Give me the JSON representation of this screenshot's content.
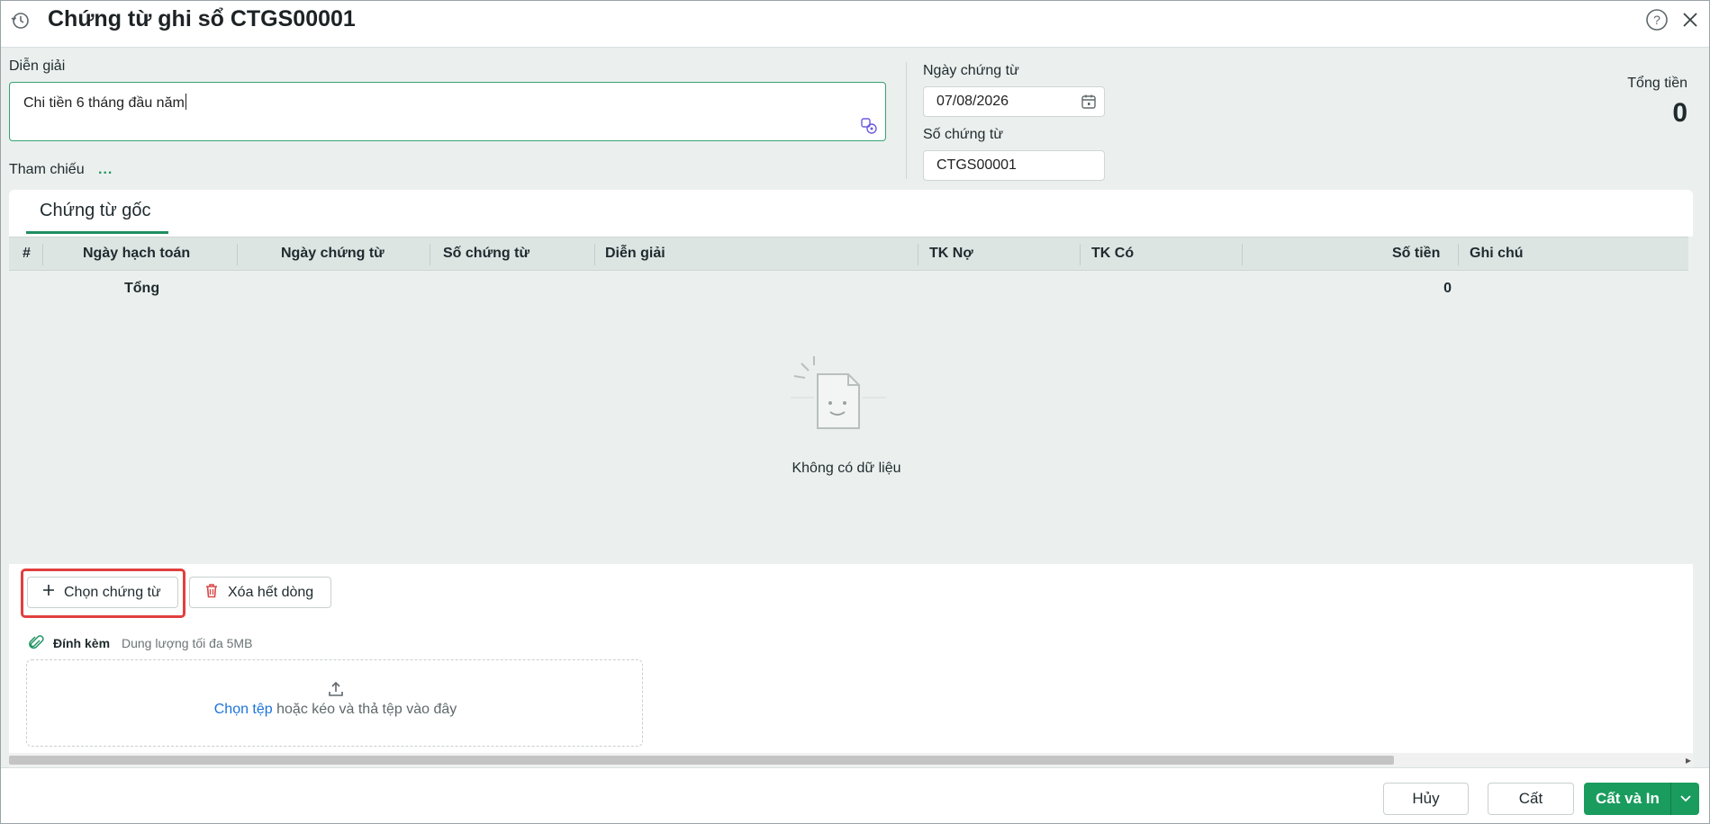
{
  "header": {
    "title": "Chứng từ ghi sổ CTGS00001",
    "icons": {
      "history": "history-icon",
      "help": "help-icon",
      "close": "close-icon"
    }
  },
  "form": {
    "description_label": "Diễn giải",
    "description_value": "Chi tiền 6 tháng đầu năm",
    "reference_label": "Tham chiếu",
    "reference_link": "...",
    "date_label": "Ngày chứng từ",
    "date_value": "07/08/2026",
    "number_label": "Số chứng từ",
    "number_value": "CTGS00001",
    "total_label": "Tổng tiền",
    "total_value": "0"
  },
  "tabs": [
    {
      "label": "Chứng từ gốc",
      "active": true
    }
  ],
  "grid": {
    "columns": [
      "#",
      "Ngày hạch toán",
      "Ngày chứng từ",
      "Số chứng từ",
      "Diễn giải",
      "TK Nợ",
      "TK Có",
      "Số tiền",
      "Ghi chú"
    ],
    "summary_label": "Tổng",
    "summary_amount": "0",
    "empty_text": "Không có dữ liệu"
  },
  "actions": {
    "select_docs": "Chọn chứng từ",
    "clear_rows": "Xóa hết dòng"
  },
  "attachment": {
    "label": "Đính kèm",
    "hint": "Dung lượng tối đa 5MB",
    "choose_link": "Chọn tệp",
    "drop_text": " hoặc kéo và thả tệp vào đây"
  },
  "footer": {
    "cancel": "Hủy",
    "save": "Cất",
    "save_print": "Cất và In"
  },
  "colors": {
    "accent": "#1a9c5e",
    "highlight": "#e0403f",
    "link": "#1a73d9"
  }
}
